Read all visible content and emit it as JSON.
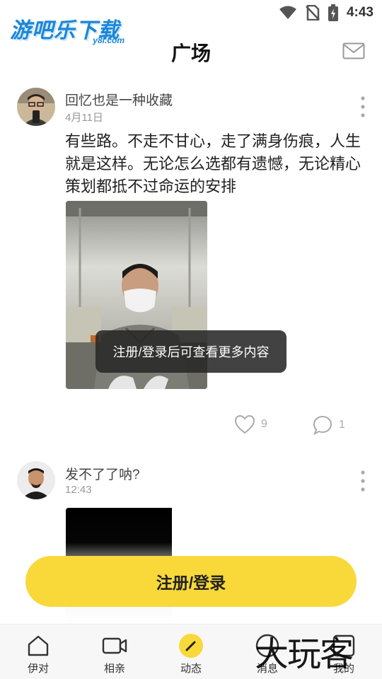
{
  "status": {
    "time": "4:43"
  },
  "watermark": {
    "logo_text": "游吧乐下载",
    "logo_sub": "y8l.com",
    "corner_text": "大玩客"
  },
  "header": {
    "title": "广场",
    "mail_icon": "mail-icon"
  },
  "posts": [
    {
      "user": "回忆也是一种收藏",
      "time": "4月11日",
      "text": "有些路。不走不甘心，走了满身伤痕，人生就是这样。无论怎么选都有遗憾，无论精心策划都抵不过命运的安排",
      "likes": "9",
      "comments": "1"
    },
    {
      "user": "发不了了呐?",
      "time": "12:43"
    }
  ],
  "toast": "注册/登录后可查看更多内容",
  "login_button": "注册/登录",
  "nav": [
    {
      "label": "伊对",
      "icon": "home-icon"
    },
    {
      "label": "相亲",
      "icon": "video-icon"
    },
    {
      "label": "动态",
      "icon": "pen-icon",
      "active": true
    },
    {
      "label": "消息",
      "icon": "chat-icon"
    },
    {
      "label": "我的",
      "icon": "profile-icon"
    }
  ],
  "colors": {
    "accent": "#f9d83a",
    "logo_blue": "#1d86d8",
    "muted": "#999999"
  }
}
